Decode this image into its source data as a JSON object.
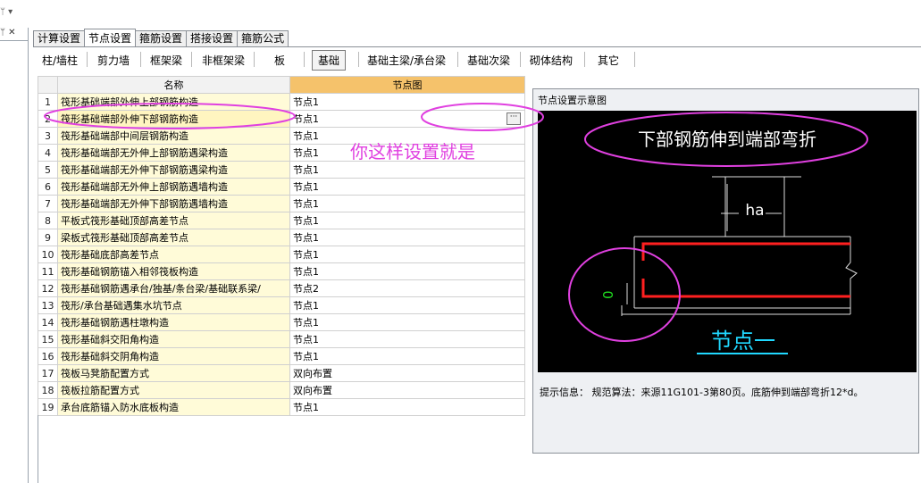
{
  "tabs": [
    "计算设置",
    "节点设置",
    "箍筋设置",
    "搭接设置",
    "箍筋公式"
  ],
  "subtabs": [
    "柱/墙柱",
    "剪力墙",
    "框架梁",
    "非框架梁",
    "板",
    "基础",
    "基础主梁/承台梁",
    "基础次梁",
    "砌体结构",
    "其它"
  ],
  "table": {
    "headers": {
      "name": "名称",
      "image": "节点图"
    },
    "rows": [
      {
        "no": "1",
        "name": "筏形基础端部外伸上部钢筋构造",
        "value": "节点1"
      },
      {
        "no": "2",
        "name": "筏形基础端部外伸下部钢筋构造",
        "value": "节点1"
      },
      {
        "no": "3",
        "name": "筏形基础端部中间层钢筋构造",
        "value": "节点1"
      },
      {
        "no": "4",
        "name": "筏形基础端部无外伸上部钢筋遇梁构造",
        "value": "节点1"
      },
      {
        "no": "5",
        "name": "筏形基础端部无外伸下部钢筋遇梁构造",
        "value": "节点1"
      },
      {
        "no": "6",
        "name": "筏形基础端部无外伸上部钢筋遇墙构造",
        "value": "节点1"
      },
      {
        "no": "7",
        "name": "筏形基础端部无外伸下部钢筋遇墙构造",
        "value": "节点1"
      },
      {
        "no": "8",
        "name": "平板式筏形基础顶部高差节点",
        "value": "节点1"
      },
      {
        "no": "9",
        "name": "梁板式筏形基础顶部高差节点",
        "value": "节点1"
      },
      {
        "no": "10",
        "name": "筏形基础底部高差节点",
        "value": "节点1"
      },
      {
        "no": "11",
        "name": "筏形基础钢筋锚入相邻筏板构造",
        "value": "节点1"
      },
      {
        "no": "12",
        "name": "筏形基础钢筋遇承台/独基/条台梁/基础联系梁/",
        "value": "节点2"
      },
      {
        "no": "13",
        "name": "筏形/承台基础遇集水坑节点",
        "value": "节点1"
      },
      {
        "no": "14",
        "name": "筏形基础钢筋遇柱墩构造",
        "value": "节点1"
      },
      {
        "no": "15",
        "name": "筏形基础斜交阳角构造",
        "value": "节点1"
      },
      {
        "no": "16",
        "name": "筏形基础斜交阴角构造",
        "value": "节点1"
      },
      {
        "no": "17",
        "name": "筏板马凳筋配置方式",
        "value": "双向布置"
      },
      {
        "no": "18",
        "name": "筏板拉筋配置方式",
        "value": "双向布置"
      },
      {
        "no": "19",
        "name": "承台底筋锚入防水底板构造",
        "value": "节点1"
      }
    ]
  },
  "panel": {
    "title": "节点设置示意图",
    "heading": "下部钢筋伸到端部弯折",
    "dim_label": "ha",
    "zero_label": "0",
    "node_caption": "节点一",
    "info": "提示信息：  规范算法：来源11G101-3第80页。底筋伸到端部弯折12*d。"
  },
  "annotation": {
    "text": "你这样设置就是",
    "color": "#e040e0"
  },
  "leftpane": {
    "header": "ᛘ ✕"
  },
  "topbar": {
    "left": "ᛘ ▾"
  }
}
